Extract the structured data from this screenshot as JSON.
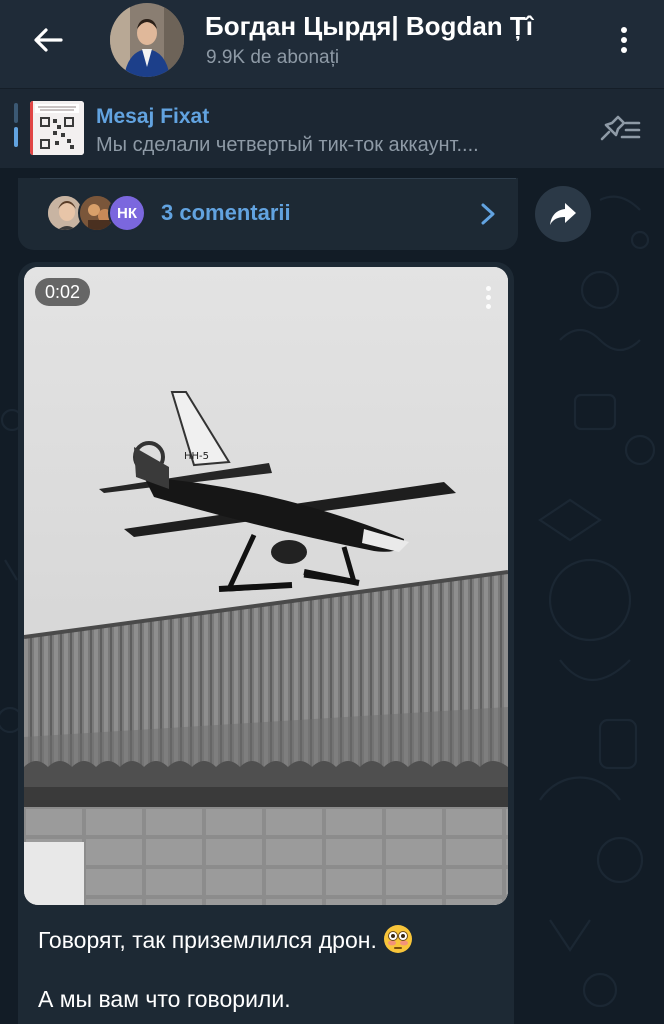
{
  "header": {
    "channel_title": "Богдан Цырдя| Bogdan Țî",
    "subscribers": "9.9K de abonați"
  },
  "pinned": {
    "title": "Mesaj Fixat",
    "text": "Мы сделали четвертый тик-ток аккаунт...."
  },
  "comments": {
    "label": "3 comentarii",
    "avatar_initials": "НК"
  },
  "message": {
    "video_duration": "0:02",
    "line1": "Говорят, так приземлился дрон.",
    "line2": "А мы вам что говорили."
  },
  "colors": {
    "header_bg": "#1f2b38",
    "accent": "#62a3e0",
    "bubble_bg": "#1d2934",
    "wallpaper_bg": "#121c26",
    "secondary_text": "#8e9aa6"
  },
  "icons": {
    "back": "arrow-left-icon",
    "menu": "more-vertical-icon",
    "unpin": "pin-list-icon",
    "chevron": "chevron-right-icon",
    "share": "share-arrow-icon",
    "emoji": "flushed-face-emoji"
  }
}
